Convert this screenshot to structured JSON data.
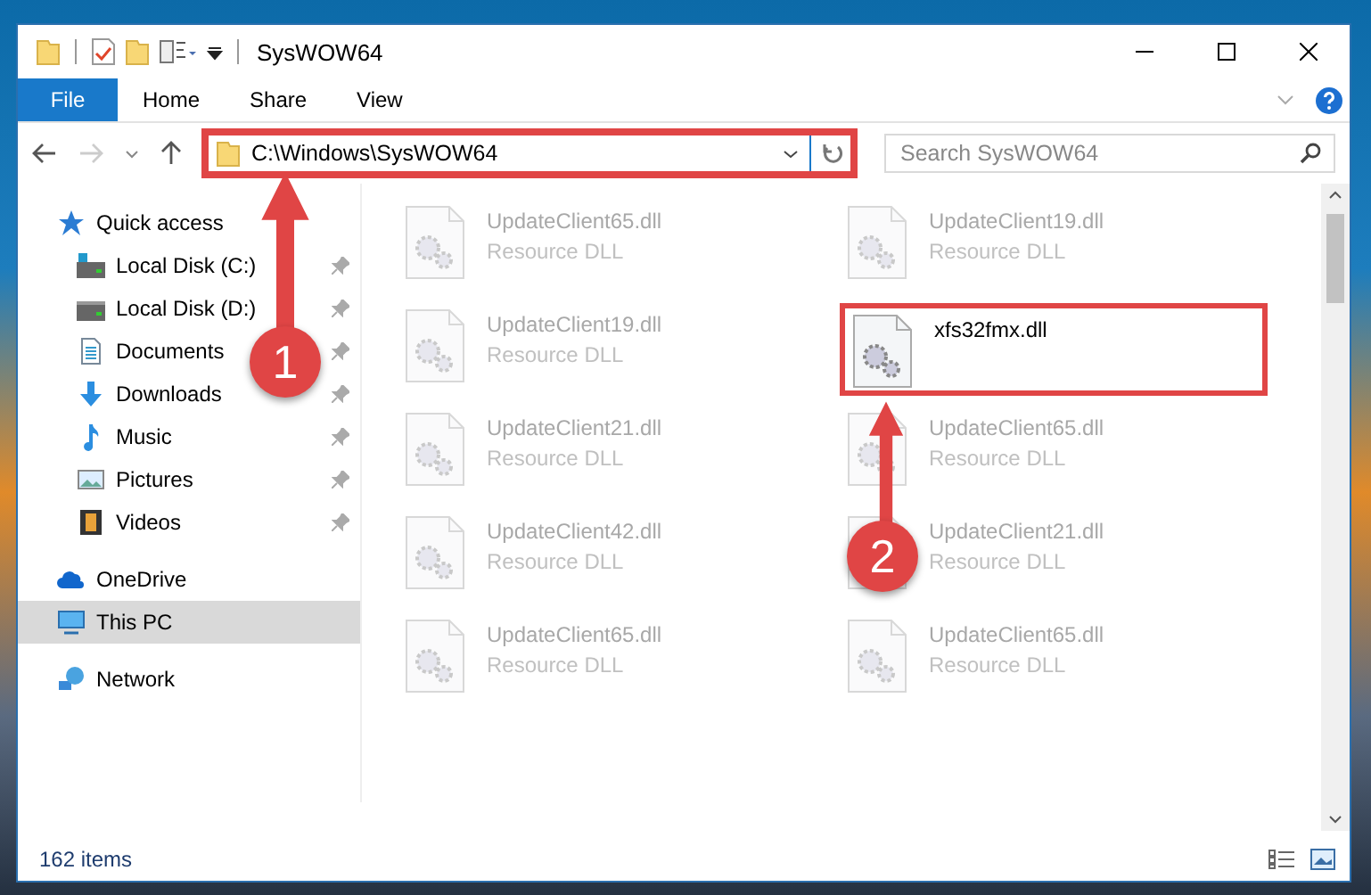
{
  "window": {
    "title": "SysWOW64"
  },
  "ribbon_tabs": [
    {
      "label": "File",
      "selected": true
    },
    {
      "label": "Home",
      "selected": false
    },
    {
      "label": "Share",
      "selected": false
    },
    {
      "label": "View",
      "selected": false
    }
  ],
  "address": {
    "value": "C:\\Windows\\SysWOW64",
    "highlighted": true
  },
  "search": {
    "placeholder": "Search SysWOW64"
  },
  "sidebar": {
    "items": [
      {
        "label": "Quick access",
        "kind": "group",
        "pinned": false,
        "selected": false
      },
      {
        "label": "Local Disk (C:)",
        "kind": "item",
        "pinned": true,
        "selected": false
      },
      {
        "label": "Local Disk (D:)",
        "kind": "item",
        "pinned": true,
        "selected": false
      },
      {
        "label": "Documents",
        "kind": "item",
        "pinned": true,
        "selected": false
      },
      {
        "label": "Downloads",
        "kind": "item",
        "pinned": true,
        "selected": false
      },
      {
        "label": "Music",
        "kind": "item",
        "pinned": true,
        "selected": false
      },
      {
        "label": "Pictures",
        "kind": "item",
        "pinned": true,
        "selected": false
      },
      {
        "label": "Videos",
        "kind": "item",
        "pinned": true,
        "selected": false
      },
      {
        "label": "OneDrive",
        "kind": "group",
        "pinned": false,
        "selected": false
      },
      {
        "label": "This PC",
        "kind": "group",
        "pinned": false,
        "selected": true
      },
      {
        "label": "Network",
        "kind": "group",
        "pinned": false,
        "selected": false
      }
    ]
  },
  "files": [
    {
      "name": "UpdateClient65.dll",
      "type": "Resource DLL",
      "blurred": true,
      "highlighted": false
    },
    {
      "name": "UpdateClient19.dll",
      "type": "Resource DLL",
      "blurred": true,
      "highlighted": false
    },
    {
      "name": "UpdateClient19.dll",
      "type": "Resource DLL",
      "blurred": true,
      "highlighted": false
    },
    {
      "name": "xfs32fmx.dll",
      "blurred": false,
      "highlighted": true
    },
    {
      "name": "UpdateClient21.dll",
      "type": "Resource DLL",
      "blurred": true,
      "highlighted": false
    },
    {
      "name": "UpdateClient65.dll",
      "type": "Resource DLL",
      "blurred": true,
      "highlighted": false
    },
    {
      "name": "UpdateClient42.dll",
      "type": "Resource DLL",
      "blurred": true,
      "highlighted": false
    },
    {
      "name": "UpdateClient21.dll",
      "type": "Resource DLL",
      "blurred": true,
      "highlighted": false
    },
    {
      "name": "UpdateClient65.dll",
      "type": "Resource DLL",
      "blurred": true,
      "highlighted": false
    },
    {
      "name": "UpdateClient65.dll",
      "type": "Resource DLL",
      "blurred": true,
      "highlighted": false
    }
  ],
  "status_bar": {
    "item_count": "162 items"
  },
  "annotations": [
    {
      "number": "1"
    },
    {
      "number": "2"
    }
  ]
}
